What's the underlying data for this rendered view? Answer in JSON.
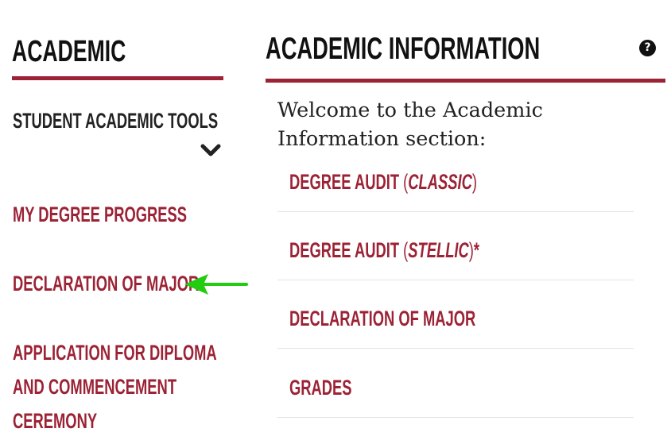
{
  "sidebar": {
    "title": "ACADEMIC",
    "section_label": "STUDENT ACADEMIC TOOLS",
    "links": [
      {
        "label": "MY DEGREE PROGRESS"
      },
      {
        "label": "DECLARATION OF MAJOR"
      },
      {
        "label_line1": "APPLICATION FOR DIPLOMA",
        "label_line2": "AND COMMENCEMENT",
        "label_line3": "CEREMONY"
      }
    ]
  },
  "main": {
    "title": "ACADEMIC INFORMATION",
    "help_icon_glyph": "?",
    "welcome_text": "Welcome to the Academic Information section:",
    "items": [
      {
        "prefix": "DEGREE AUDIT",
        "open": "(",
        "italic": "CLASSIC",
        "close": ")",
        "suffix": ""
      },
      {
        "prefix": "DEGREE AUDIT",
        "open": "(",
        "italic": "STELLIC",
        "close": ")",
        "suffix": "*"
      },
      {
        "label": "DECLARATION OF MAJOR"
      },
      {
        "label": "GRADES"
      }
    ]
  },
  "annotation": {
    "icon": "green-arrow-icon",
    "color": "#22cc11"
  },
  "colors": {
    "accent": "#9c2235",
    "text": "#111111"
  }
}
